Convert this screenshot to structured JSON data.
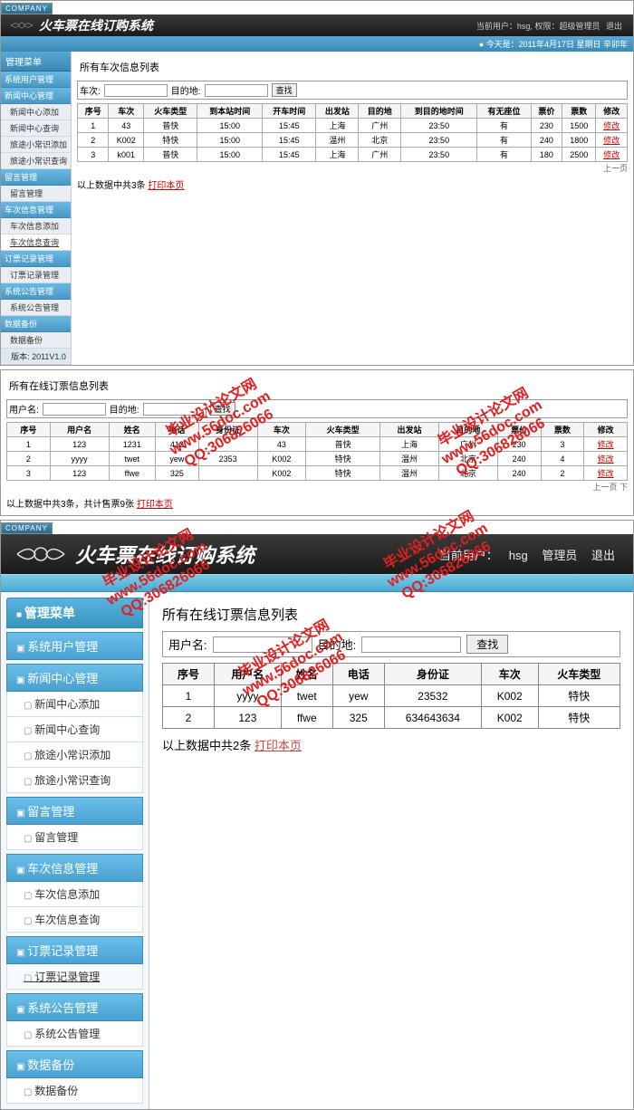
{
  "company_tag": "COMPANY",
  "app_title": "火车票在线订购系统",
  "header": {
    "user_label": "当前用户：",
    "user": "hsg",
    "role_label": "权限：",
    "role": "超级管理员",
    "logout": "退出"
  },
  "date_bar": "今天是：2011年4月17日 星期日 辛卯年",
  "sidebar": {
    "title": "管理菜单",
    "sections": [
      {
        "cat": "系统用户管理",
        "items": []
      },
      {
        "cat": "新闻中心管理",
        "items": [
          "新闻中心添加",
          "新闻中心查询",
          "旅途小常识添加",
          "旅途小常识查询"
        ]
      },
      {
        "cat": "留言管理",
        "items": [
          "留言管理"
        ]
      },
      {
        "cat": "车次信息管理",
        "items": [
          "车次信息添加",
          "车次信息查询"
        ]
      },
      {
        "cat": "订票记录管理",
        "items": [
          "订票记录管理"
        ]
      },
      {
        "cat": "系统公告管理",
        "items": [
          "系统公告管理"
        ]
      },
      {
        "cat": "数据备份",
        "items": [
          "数据备份"
        ]
      }
    ],
    "footer": "版本: 2011V1.0"
  },
  "top_active_item": "车次信息查询",
  "train_list": {
    "title": "所有车次信息列表",
    "search": {
      "label1": "车次:",
      "label2": "目的地:",
      "btn": "查找"
    },
    "cols": [
      "序号",
      "车次",
      "火车类型",
      "到本站时间",
      "开车时间",
      "出发站",
      "目的地",
      "到目的地时间",
      "有无座位",
      "票价",
      "票数",
      "修改"
    ],
    "rows": [
      [
        "1",
        "43",
        "普快",
        "15:00",
        "15:45",
        "上海",
        "广州",
        "23:50",
        "有",
        "230",
        "1500",
        "修改"
      ],
      [
        "2",
        "K002",
        "特快",
        "15:00",
        "15:45",
        "温州",
        "北京",
        "23:50",
        "有",
        "240",
        "1800",
        "修改"
      ],
      [
        "3",
        "k001",
        "普快",
        "15:00",
        "15:45",
        "上海",
        "广州",
        "23:50",
        "有",
        "180",
        "2500",
        "修改"
      ]
    ],
    "summary_pre": "以上数据中共3条",
    "summary_link": "打印本页",
    "pager": "上一页"
  },
  "booking_list": {
    "title": "所有在线订票信息列表",
    "search": {
      "label1": "用户名:",
      "label2": "目的地:",
      "btn": "查找"
    },
    "cols": [
      "序号",
      "用户名",
      "姓名",
      "电话",
      "身份证",
      "车次",
      "火车类型",
      "出发站",
      "目的地",
      "票价",
      "票数",
      "修改"
    ],
    "rows": [
      [
        "1",
        "123",
        "1231",
        "412",
        "",
        "43",
        "普快",
        "上海",
        "广州",
        "230",
        "3",
        "修改"
      ],
      [
        "2",
        "yyyy",
        "twet",
        "yew",
        "2353",
        "K002",
        "特快",
        "温州",
        "北京",
        "240",
        "4",
        "修改"
      ],
      [
        "3",
        "123",
        "ffwe",
        "325",
        "",
        "K002",
        "特快",
        "温州",
        "北京",
        "240",
        "2",
        "修改"
      ]
    ],
    "summary_pre": "以上数据中共3条，共计售票9张",
    "summary_link": "打印本页",
    "pager": "上一页 下"
  },
  "big": {
    "header": {
      "user_label": "当前用户：",
      "user": "hsg",
      "role_part": "管理员",
      "logout": "退出"
    },
    "active_item": "订票记录管理",
    "list": {
      "title": "所有在线订票信息列表",
      "search": {
        "label1": "用户名:",
        "label2": "目的地:",
        "btn": "查找"
      },
      "cols": [
        "序号",
        "用户名",
        "姓名",
        "电话",
        "身份证",
        "车次",
        "火车类型"
      ],
      "rows": [
        [
          "1",
          "yyyy",
          "twet",
          "yew",
          "23532",
          "K002",
          "特快"
        ],
        [
          "2",
          "123",
          "ffwe",
          "325",
          "634643634",
          "K002",
          "特快"
        ]
      ],
      "summary_pre": "以上数据中共2条",
      "summary_link": "打印本页"
    }
  },
  "watermark": {
    "line1": "毕业设计论文网",
    "line2": "www.56doc.com",
    "line3": "QQ:306826066"
  }
}
